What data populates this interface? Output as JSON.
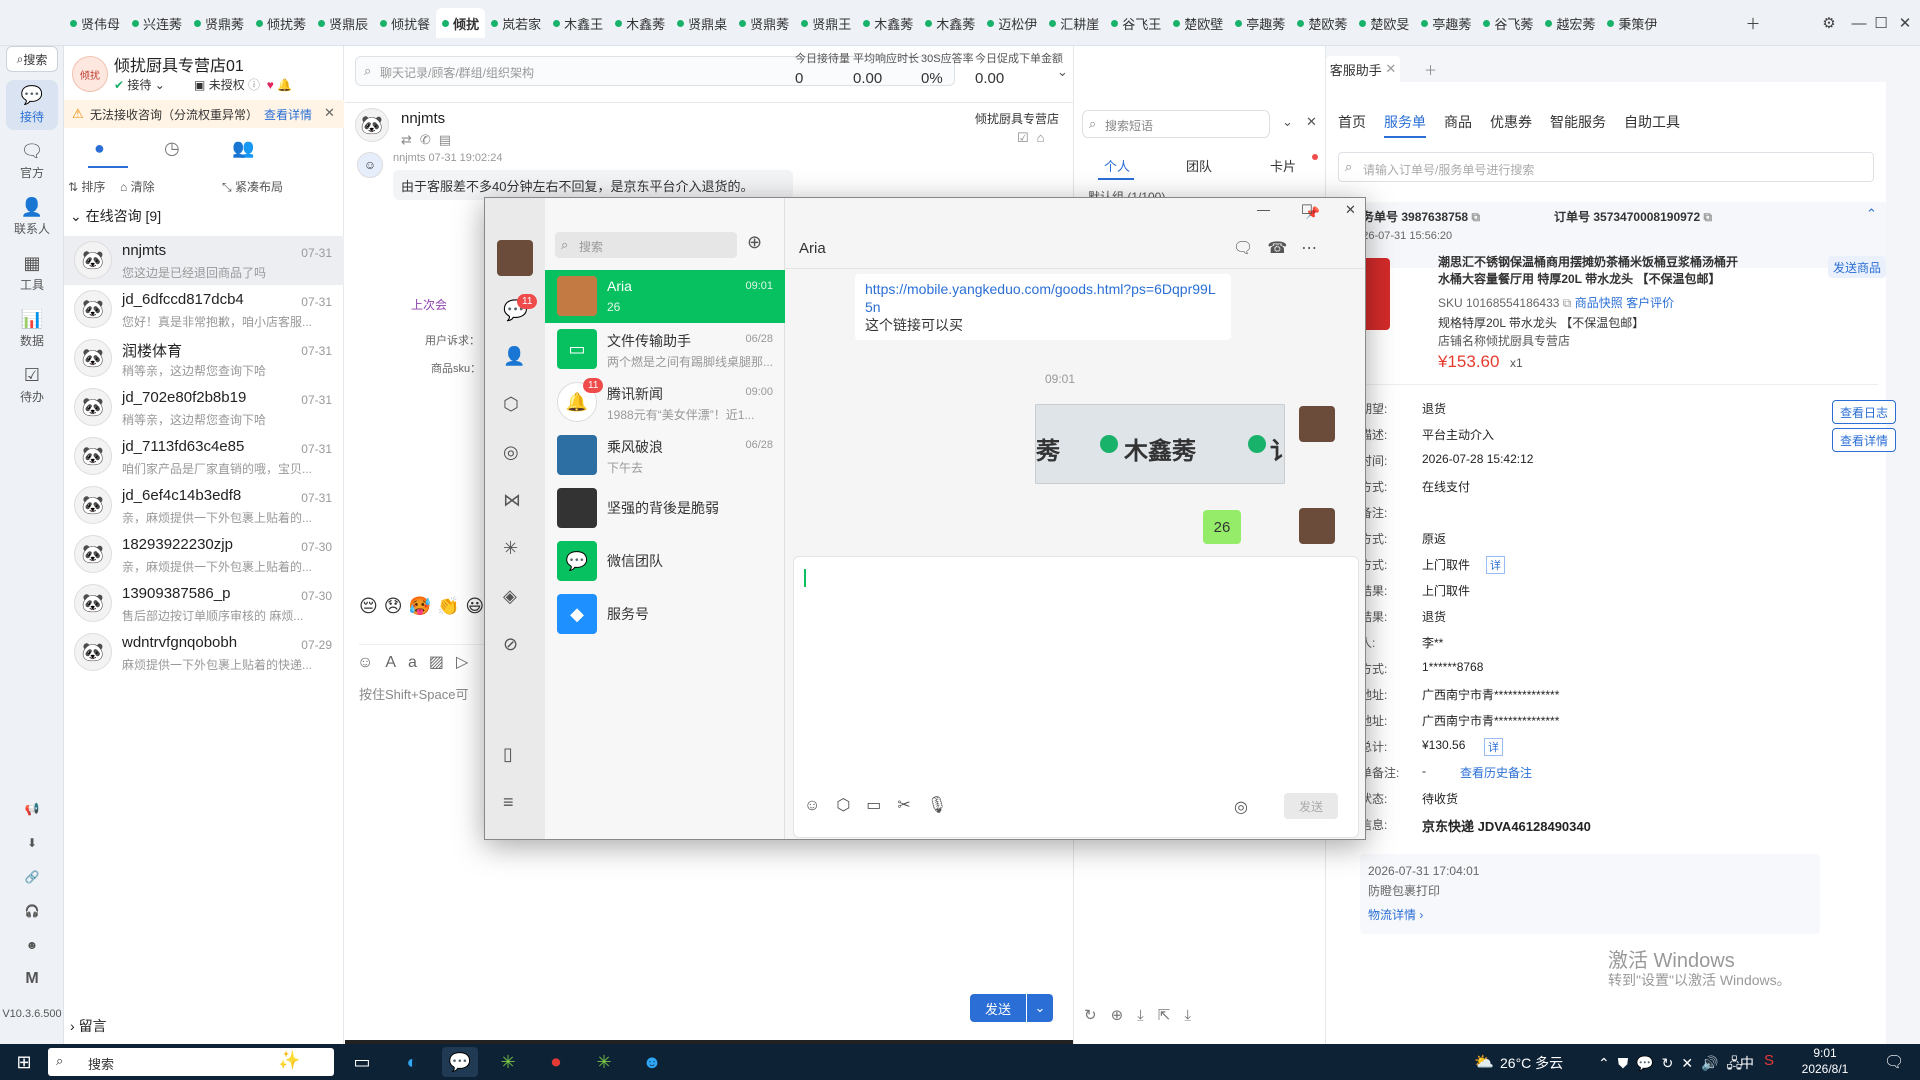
{
  "tabs": [
    "贤伟母",
    "兴连莠",
    "贤鼎莠",
    "倾扰莠",
    "贤鼎辰",
    "倾扰餐",
    "倾扰",
    "岚若家",
    "木鑫王",
    "木鑫莠",
    "贤鼎桌",
    "贤鼎莠",
    "贤鼎王",
    "木鑫莠",
    "木鑫莠",
    "迈松伊",
    "汇耕崖",
    "谷飞王",
    "楚欧壁",
    "亭趣莠",
    "楚欧莠",
    "楚欧旻",
    "亭趣莠",
    "谷飞莠",
    "越宏莠",
    "秉策伊"
  ],
  "active_tab_index": 6,
  "rail": {
    "search": "搜索",
    "items": [
      "接待",
      "官方",
      "联系人",
      "工具",
      "数据",
      "待办"
    ],
    "version": "V10.3.6.500"
  },
  "shop": {
    "name": "倾扰厨具专营店01",
    "status": "接待",
    "auth": "未授权",
    "warning": "无法接收咨询（分流权重异常）",
    "warning_link": "查看详情",
    "sort": "排序",
    "clear": "清除",
    "layout": "紧凑布局",
    "section": "在线咨询 [9]",
    "footer": "留言"
  },
  "conversations": [
    {
      "name": "nnjmts",
      "date": "07-31",
      "preview": "您这边是已经退回商品了吗"
    },
    {
      "name": "jd_6dfccd817dcb4",
      "date": "07-31",
      "preview": "您好！真是非常抱歉，咱小店客服..."
    },
    {
      "name": "润楼体育",
      "date": "07-31",
      "preview": "稍等亲，这边帮您查询下哈"
    },
    {
      "name": "jd_702e80f2b8b19",
      "date": "07-31",
      "preview": "稍等亲，这边帮您查询下哈"
    },
    {
      "name": "jd_7113fd63c4e85",
      "date": "07-31",
      "preview": "咱们家产品是厂家直销的哦，宝贝..."
    },
    {
      "name": "jd_6ef4c14b3edf8",
      "date": "07-31",
      "preview": "亲，麻烦提供一下外包裹上贴着的..."
    },
    {
      "name": "18293922230zjp",
      "date": "07-30",
      "preview": "亲，麻烦提供一下外包裹上贴着的..."
    },
    {
      "name": "13909387586_p",
      "date": "07-30",
      "preview": "售后部边按订单顺序审核的 麻烦..."
    },
    {
      "name": "wdntrvfgnqobobh",
      "date": "07-29",
      "preview": "麻烦提供一下外包裹上贴着的快递..."
    }
  ],
  "chat": {
    "search_placeholder": "聊天记录/顾客/群组/组织架构",
    "stats": [
      {
        "label": "今日接待量",
        "value": "0"
      },
      {
        "label": "平均响应时长",
        "value": "0.00"
      },
      {
        "label": "30S应答率",
        "value": "0%"
      },
      {
        "label": "今日促成下单金额",
        "value": "0.00"
      }
    ],
    "customer": "nnjmts",
    "shop_tag": "倾扰厨具专营店",
    "msg_meta": "nnjmts 07-31 19:02:24",
    "msg_text": "由于客服差不多40分钟左右不回复，是京东平台介入退货的。",
    "last_consult": "上次会",
    "user_req": "用户诉求：",
    "sku_label": "商品sku：",
    "input_hint": "按住Shift+Space可",
    "send": "发送"
  },
  "quick": {
    "placeholder": "搜索短语",
    "tabs": [
      "个人",
      "团队",
      "卡片"
    ],
    "group": "默认组 (1/100)"
  },
  "assistant": {
    "tab": "客服助手",
    "nav": [
      "首页",
      "服务单",
      "商品",
      "优惠券",
      "智能服务",
      "自助工具"
    ],
    "search_placeholder": "请输入订单号/服务单号进行搜索",
    "service_no_label": "服务单号",
    "service_no": "3987638758",
    "order_no_label": "订单号",
    "order_no": "3573470008190972",
    "created": "2026-07-31 15:56:20",
    "product_title": "潮思汇不锈钢保温桶商用摆摊奶茶桶米饭桶豆浆桶汤桶开水桶大容量餐厅用 特厚20L 带水龙头 【不保温包邮】",
    "send_goods": "发送商品",
    "sku": "SKU 10168554186433",
    "snapshot": "商品快照",
    "review": "客户评价",
    "spec": "规格特厚20L 带水龙头 【不保温包邮】",
    "store": "店铺名称倾扰厨具专营店",
    "price": "¥153.60",
    "qty": "x1",
    "view_log": "查看日志",
    "view_detail": "查看详情",
    "fields": [
      {
        "k": "客户期望:",
        "v": "退货"
      },
      {
        "k": "问题描述:",
        "v": "平台主动介入"
      },
      {
        "k": "下单时间:",
        "v": "2026-07-28 15:42:12"
      },
      {
        "k": "支付方式:",
        "v": "在线支付"
      },
      {
        "k": "订单备注:",
        "v": ""
      },
      {
        "k": "退款方式:",
        "v": "原返"
      },
      {
        "k": "返回方式:",
        "v": "上门取件"
      },
      {
        "k": "审核结果:",
        "v": "上门取件"
      },
      {
        "k": "处理结果:",
        "v": "退货"
      },
      {
        "k": "联系人:",
        "v": "李**"
      },
      {
        "k": "联系方式:",
        "v": "1******8768"
      },
      {
        "k": "取件地址:",
        "v": "广西南宁市青**************"
      },
      {
        "k": "收货地址:",
        "v": "广西南宁市青**************"
      },
      {
        "k": "金额总计:",
        "v": "¥130.56"
      },
      {
        "k": "服务单备注:",
        "v": "-"
      },
      {
        "k": "目前状态:",
        "v": "待收货"
      },
      {
        "k": "物流信息:",
        "v": "京东快递 JDVA46128490340"
      }
    ],
    "detail_tag": "详",
    "history_remark": "查看历史备注",
    "logistics_time": "2026-07-31 17:04:01",
    "logistics_text": "防瞪包裹打印",
    "logistics_link": "物流详情",
    "activate1": "激活 Windows",
    "activate2": "转到\"设置\"以激活 Windows。"
  },
  "wechat": {
    "search_placeholder": "搜索",
    "chat_title": "Aria",
    "badge_chats": "11",
    "list": [
      {
        "name": "Aria",
        "time": "09:01",
        "preview": "26"
      },
      {
        "name": "文件传输助手",
        "time": "06/28",
        "preview": "两个燃是之间有踢脚线桌腿那..."
      },
      {
        "name": "腾讯新闻",
        "time": "09:00",
        "preview": "1988元有“美女伴漂”！近1..."
      },
      {
        "name": "乘风破浪",
        "time": "06/28",
        "preview": "下午去"
      },
      {
        "name": "坚强的背後是脆弱",
        "time": "",
        "preview": ""
      },
      {
        "name": "微信团队",
        "time": "",
        "preview": ""
      },
      {
        "name": "服务号",
        "time": "",
        "preview": ""
      }
    ],
    "news_badge": "11",
    "link_text": "https://mobile.yangkeduo.com/goods.html?ps=6Dqpr99L5n",
    "link_caption": "这个链接可以买",
    "time_sep": "09:01",
    "image_text": "木鑫莠",
    "image_text_left": "莠",
    "image_text_right": "讠",
    "my_msg": "26",
    "send": "发送"
  },
  "taskbar": {
    "search": "搜索",
    "weather": "26°C 多云",
    "ime": "中",
    "time": "9:01",
    "date": "2026/8/1"
  }
}
